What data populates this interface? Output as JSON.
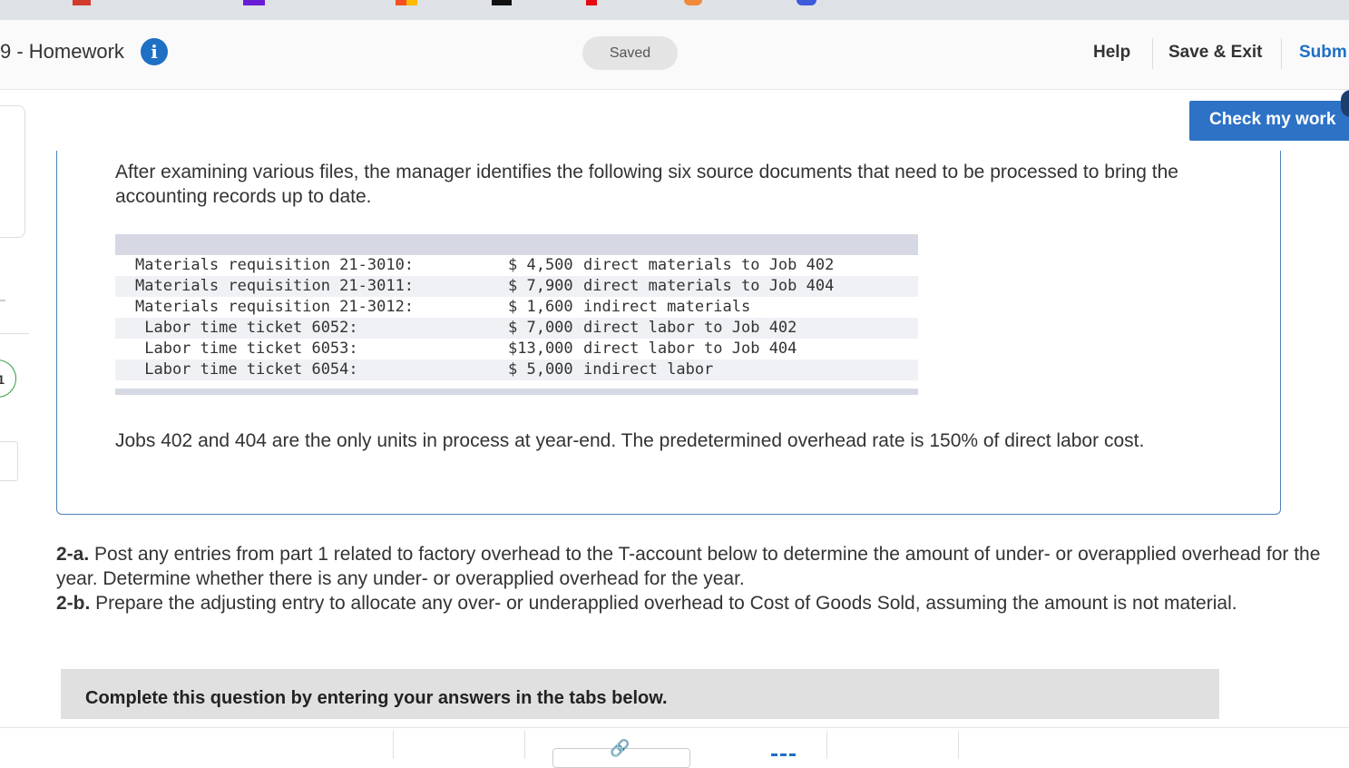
{
  "header": {
    "title": "9 - Homework",
    "saved_label": "Saved",
    "help_label": "Help",
    "save_exit_label": "Save & Exit",
    "submit_label": "Subm",
    "check_label": "Check my work"
  },
  "sidebar": {
    "question_number": "1"
  },
  "intro": "After examining various files, the manager identifies the following six source documents that need to be processed to bring the accounting records up to date.",
  "documents": [
    {
      "label": "Materials requisition 21-3010:",
      "amount": "$ 4,500",
      "description": "direct materials to Job 402"
    },
    {
      "label": "Materials requisition 21-3011:",
      "amount": "$ 7,900",
      "description": "direct materials to Job 404"
    },
    {
      "label": "Materials requisition 21-3012:",
      "amount": "$ 1,600",
      "description": "indirect materials"
    },
    {
      "label": " Labor time ticket 6052:",
      "amount": "$ 7,000",
      "description": "direct labor to Job 402"
    },
    {
      "label": " Labor time ticket 6053:",
      "amount": "$13,000",
      "description": "direct labor to Job 404"
    },
    {
      "label": " Labor time ticket 6054:",
      "amount": "$ 5,000",
      "description": "indirect labor"
    }
  ],
  "note": "Jobs 402 and 404 are the only units in process at year-end. The predetermined overhead rate is 150% of direct labor cost.",
  "question": {
    "a_label": "2-a.",
    "a_text": " Post any entries from part 1 related to factory overhead to the T-account below to determine the amount of under- or overapplied overhead for the year. Determine whether there is any under- or overapplied overhead for the year.",
    "b_label": "2-b.",
    "b_text": " Prepare the adjusting entry to allocate any over- or underapplied overhead to Cost of Goods Sold, assuming the amount is not material."
  },
  "complete_text": "Complete this question by entering your answers in the tabs below.",
  "colors": {
    "accent": "#1f6fc5",
    "check_button": "#2e72c5",
    "panel_border": "#4d82b8"
  }
}
